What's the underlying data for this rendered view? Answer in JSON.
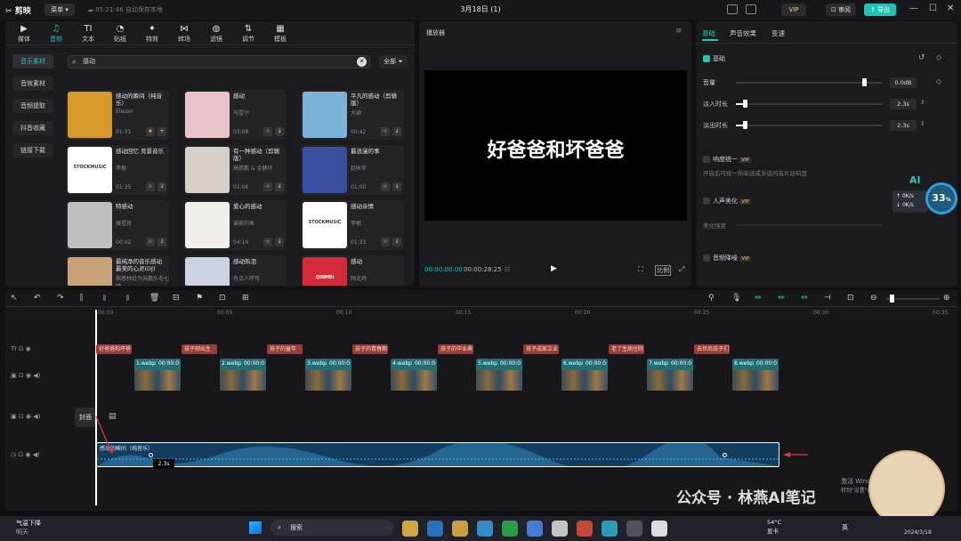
{
  "titlebar": {
    "app_name": "剪映",
    "menu_label": "菜单",
    "autosave": "05:21:46 自动保存本地",
    "project_title": "3月18日 (1)",
    "vip": "VIP",
    "review": "审阅",
    "export": "导出"
  },
  "media": {
    "tools": [
      "媒体",
      "音频",
      "文本",
      "贴纸",
      "特效",
      "转场",
      "滤镜",
      "调节",
      "模板"
    ],
    "tool_icons": [
      "media-icon",
      "audio-icon",
      "text-icon",
      "sticker-icon",
      "effect-icon",
      "transition-icon",
      "filter-icon",
      "adjust-icon",
      "template-icon"
    ],
    "side_items": [
      "音乐素材",
      "音效素材",
      "音频提取",
      "抖音收藏",
      "链接下载"
    ],
    "search_value": "感动",
    "filter_label": "全部",
    "cards": [
      {
        "name": "感动的瞬间（纯音乐）",
        "artist": "Eliezer",
        "duration": "01:31"
      },
      {
        "name": "感动",
        "artist": "马雪尔",
        "duration": "03:08"
      },
      {
        "name": "平凡的感动（剪辑版）",
        "artist": "大颖",
        "duration": "00:42"
      },
      {
        "name": "感动回忆 背景音乐",
        "artist": "李根",
        "duration": "01:35"
      },
      {
        "name": "有一种感动（剪辑版）",
        "artist": "高航鹏 & 金静环",
        "duration": "01:06"
      },
      {
        "name": "最浪漫的事",
        "artist": "赵咏华",
        "duration": "01:00"
      },
      {
        "name": "特感动",
        "artist": "展煜良",
        "duration": "00:42"
      },
      {
        "name": "爱心的感动",
        "artist": "曾能的鱼",
        "duration": "04:16"
      },
      {
        "name": "感动亲情",
        "artist": "李根",
        "duration": "01:33"
      },
      {
        "name": "最纯净的音乐感动最美的心灵(DJ)",
        "artist": "歌者林姓为苏鹏头毛七晴",
        "duration": ""
      },
      {
        "name": "感动热泪",
        "artist": "有点人呼可",
        "duration": ""
      },
      {
        "name": "感动",
        "artist": "网北鸡",
        "duration": ""
      }
    ],
    "card_thumbs": [
      "#d79a2a",
      "#e8c4c8",
      "#7db3d9",
      "#ffffff",
      "#d8d0c8",
      "#3a4ea0",
      "#bfbfbf",
      "#f2eee8",
      "#ffffff",
      "#c9a27a",
      "#cbd3e2",
      "#d42a3a"
    ],
    "card_brand": [
      "",
      "",
      "",
      "STOCKMUSIC",
      "",
      "",
      "",
      "",
      "STOCKMUSIC",
      "",
      "",
      "QINMEI"
    ]
  },
  "player": {
    "title": "播放器",
    "subtitle": "好爸爸和坏爸爸",
    "current_time": "00:00:00:00",
    "total_time": "00:00:28:25",
    "ratio": "比例"
  },
  "inspector": {
    "tabs": [
      "基础",
      "声音效果",
      "变速"
    ],
    "section": "基础",
    "volume_label": "音量",
    "volume_value": "0.0dB",
    "volume_level": 0.88,
    "fade_in_label": "淡入时长",
    "fade_in_value": "2.3s",
    "fade_in_level": 0.06,
    "fade_out_label": "淡出时长",
    "fade_out_value": "2.3s",
    "fade_out_level": 0.06,
    "loudness_label": "响度统一",
    "loudness_desc": "开启后可统一所单选或多选的音片段响度",
    "voice_label": "人声美化",
    "beauty_label": "美化强度",
    "denoise_label": "音频降噪",
    "vip_badge": "VIP"
  },
  "overlay": {
    "ai": "AI",
    "up": "0K/s",
    "down": "0K/s",
    "percent": "33",
    "percent_unit": "%"
  },
  "timeline": {
    "ticks": [
      "00:00",
      "00:05",
      "00:10",
      "00:15",
      "00:20",
      "00:25",
      "00:30",
      "00:35"
    ],
    "text_clips": [
      "好爸爸和坏爸",
      "孩子刚出生",
      "孩子的童年",
      "孩子的青春期",
      "孩子的毕业典",
      "孩子成家立业",
      "老了生病住院",
      "去世后孩子们"
    ],
    "video_clips": [
      {
        "name": "1.webp",
        "time": "00:00:0"
      },
      {
        "name": "2.webp",
        "time": "00:00:0"
      },
      {
        "name": "3.webp",
        "time": "00:00:0"
      },
      {
        "name": "4.webp",
        "time": "00:00:0"
      },
      {
        "name": "5.webp",
        "time": "00:00:0"
      },
      {
        "name": "6.webp",
        "time": "00:00:0"
      },
      {
        "name": "7.webp",
        "time": "00:00:0"
      },
      {
        "name": "8.webp",
        "time": "00:00:0"
      }
    ],
    "cover_label": "封面",
    "audio_name": "感动的瞬间（纯音乐）",
    "tooltip": "2.3s"
  },
  "taskbar": {
    "weather": "气温下降",
    "weather_sub": "明天",
    "search": "搜索",
    "temp": "54°C",
    "temp_sub": "显卡",
    "lang": "英",
    "date": "2024/3/18"
  },
  "watermark": "公众号 · 林燕AI笔记",
  "activate": "激活 Windows",
  "activate_sub": "转到\"设置\"以激活 Windows"
}
